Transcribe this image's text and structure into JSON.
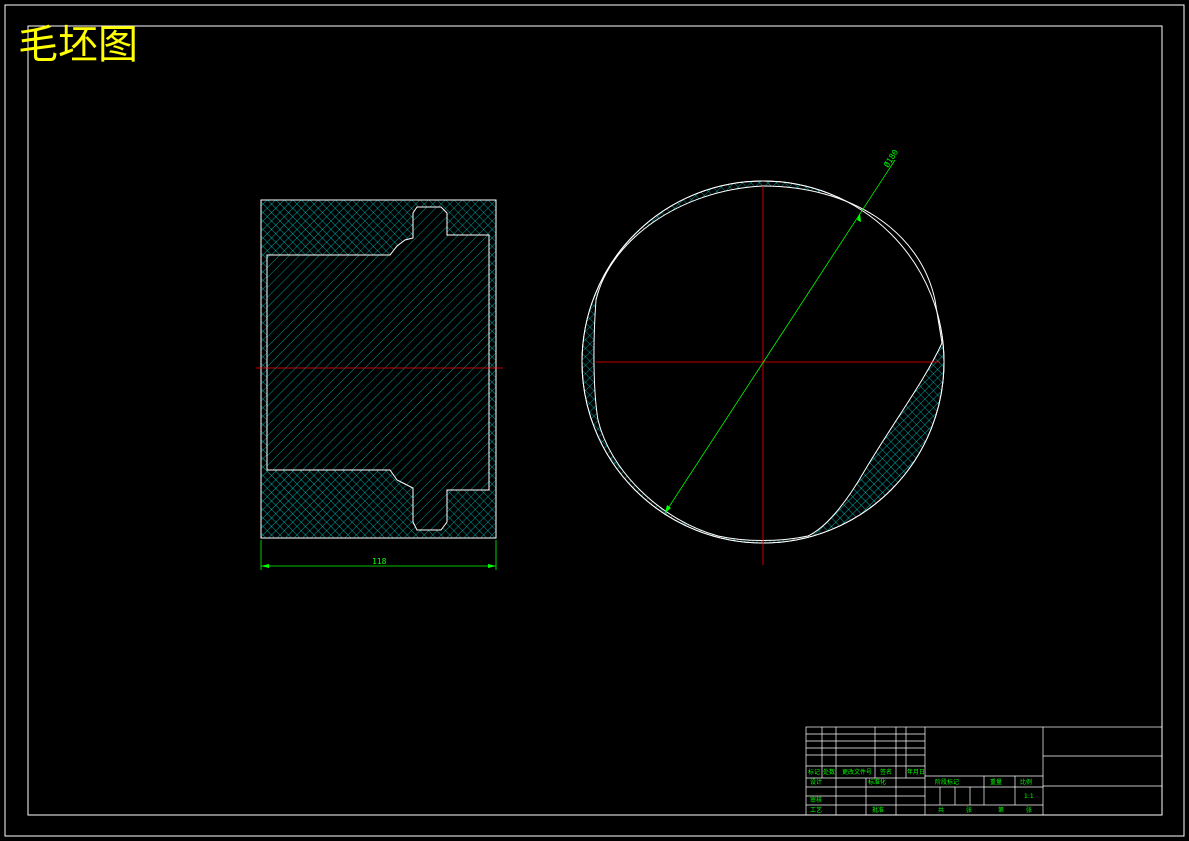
{
  "drawing": {
    "title": "毛坯图",
    "dimensions": {
      "width_label": "118",
      "diameter_label": "Ø180"
    },
    "colors": {
      "background": "#000000",
      "frame": "#ffffff",
      "outline": "#ffffff",
      "hatch": "#00ffff",
      "centerline": "#ff0000",
      "dimension": "#00ff00",
      "title": "#ffff00"
    }
  },
  "title_block": {
    "row_labels": [
      "标记",
      "处数",
      "更改文件号",
      "签名",
      "年月日"
    ],
    "design_label": "设计",
    "standardize_label": "标准化",
    "audit_label": "审核",
    "process_label": "工艺",
    "approve_label": "批准",
    "stage_label": "阶段标记",
    "weight_label": "重量",
    "scale_label": "比例",
    "scale_value": "1:1",
    "sheet_total_label": "共",
    "sheet_label": "张",
    "sheet_no_label": "第",
    "sheet_label_2": "张"
  }
}
